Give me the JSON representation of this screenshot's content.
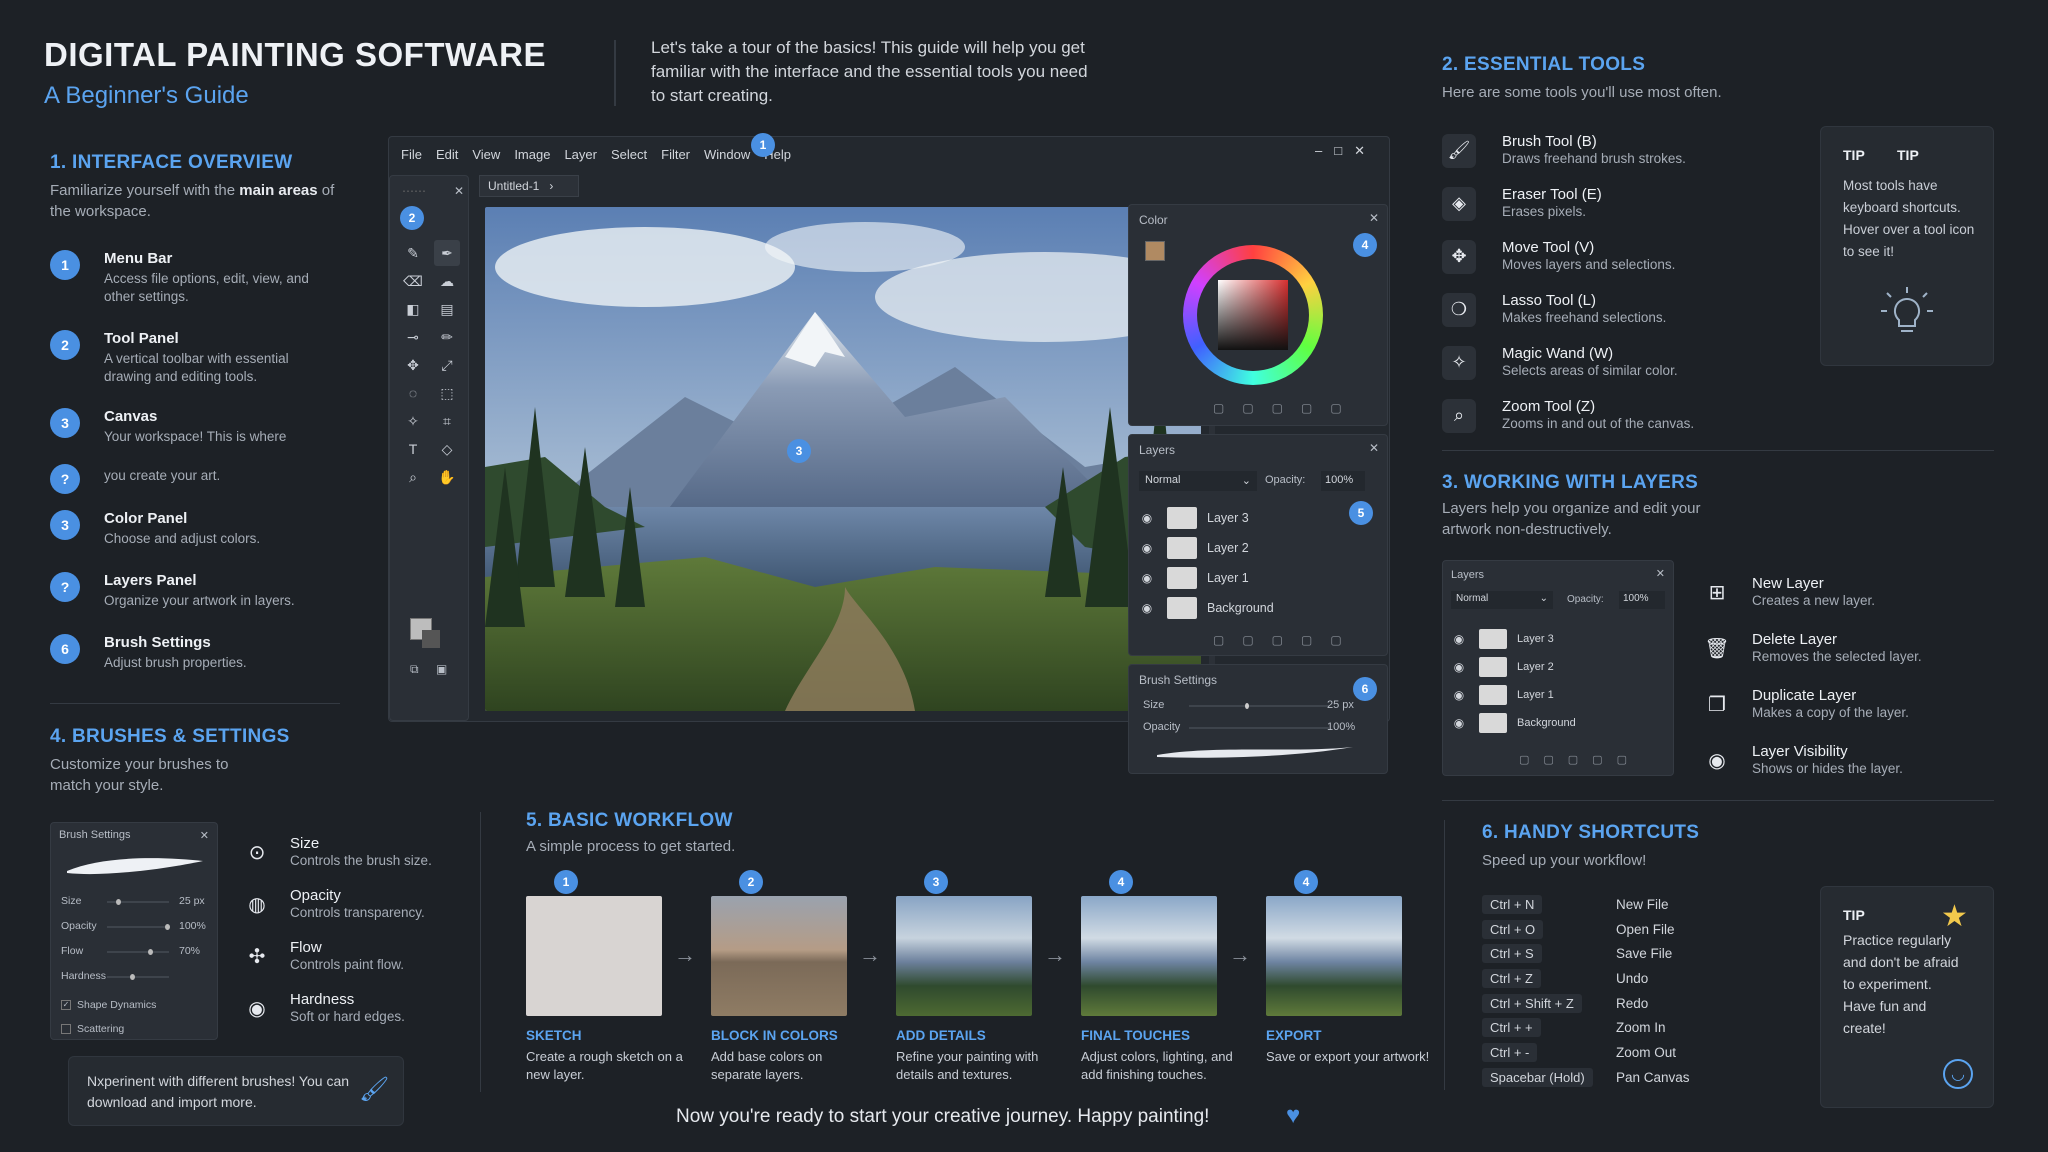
{
  "header": {
    "title": "DIGITAL PAINTING SOFTWARE",
    "subtitle": "A Beginner's Guide",
    "intro": "Let's take a tour of the basics! This guide will help you get familiar with the interface and the essential tools you need to start creating."
  },
  "interface_overview": {
    "title": "1. INTERFACE OVERVIEW",
    "desc_pre": "Familiarize yourself with the ",
    "desc_bold": "main areas",
    "desc_post": " of the workspace.",
    "items": [
      {
        "badge": "1",
        "title": "Menu Bar",
        "desc": "Access file options, edit, view, and other settings."
      },
      {
        "badge": "2",
        "title": "Tool Panel",
        "desc": "A vertical toolbar with essential drawing and editing tools."
      },
      {
        "badge": "3",
        "title": "Canvas",
        "desc": "Your workspace! This is where"
      },
      {
        "badge": "?",
        "title": "",
        "desc": "you create your art."
      },
      {
        "badge": "3",
        "title": "Color Panel",
        "desc": "Choose and adjust colors."
      },
      {
        "badge": "?",
        "title": "Layers Panel",
        "desc": "Organize your artwork in layers."
      },
      {
        "badge": "6",
        "title": "Brush Settings",
        "desc": "Adjust brush properties."
      }
    ]
  },
  "app": {
    "menu": [
      "File",
      "Edit",
      "View",
      "Image",
      "Layer",
      "Select",
      "Filter",
      "Window",
      "Help"
    ],
    "tab": "Untitled-1",
    "color_panel_title": "Color",
    "layers_panel_title": "Layers",
    "blend_mode": "Normal",
    "opacity_label": "Opacity:",
    "opacity_value": "100%",
    "layers": [
      "Layer 3",
      "Layer 2",
      "Layer 1",
      "Background"
    ],
    "brush_settings_title": "Brush Settings",
    "size_label": "Size",
    "size_value": "25 px",
    "opacity_short": "Opacity",
    "opacity_short_value": "100%",
    "badges": [
      "1",
      "2",
      "3",
      "4",
      "5",
      "6"
    ]
  },
  "essential_tools": {
    "title": "2. ESSENTIAL TOOLS",
    "desc": "Here are some tools you'll use most often.",
    "tools": [
      {
        "icon": "brush-icon",
        "title": "Brush Tool (B)",
        "desc": "Draws freehand brush strokes."
      },
      {
        "icon": "eraser-icon",
        "title": "Eraser Tool (E)",
        "desc": "Erases pixels."
      },
      {
        "icon": "move-icon",
        "title": "Move Tool (V)",
        "desc": "Moves layers and selections."
      },
      {
        "icon": "lasso-icon",
        "title": "Lasso Tool (L)",
        "desc": "Makes freehand selections."
      },
      {
        "icon": "magic-wand-icon",
        "title": "Magic Wand (W)",
        "desc": "Selects areas of similar color."
      },
      {
        "icon": "zoom-icon",
        "title": "Zoom Tool (Z)",
        "desc": "Zooms in and out of the canvas."
      }
    ],
    "tip_label": "TIP",
    "tip_label2": "TIP",
    "tip_text": "Most tools have keyboard shortcuts. Hover over a tool icon to see it!"
  },
  "layers_section": {
    "title": "3. WORKING WITH LAYERS",
    "desc": "Layers help you organize and edit your artwork non-destructively.",
    "actions": [
      {
        "icon": "new-layer-icon",
        "title": "New Layer",
        "desc": "Creates a new layer."
      },
      {
        "icon": "delete-layer-icon",
        "title": "Delete Layer",
        "desc": "Removes the selected layer."
      },
      {
        "icon": "duplicate-layer-icon",
        "title": "Duplicate Layer",
        "desc": "Makes a copy of the layer."
      },
      {
        "icon": "visibility-icon",
        "title": "Layer Visibility",
        "desc": "Shows or hides the layer."
      }
    ]
  },
  "brushes_section": {
    "title": "4. BRUSHES & SETTINGS",
    "desc": "Customize your brushes to match your style.",
    "panel_title": "Brush Settings",
    "rows": [
      {
        "label": "Size",
        "value": "25 px",
        "pos": 0.15
      },
      {
        "label": "Opacity",
        "value": "100%",
        "pos": 1.0
      },
      {
        "label": "Flow",
        "value": "70%",
        "pos": 0.7
      },
      {
        "label": "Hardness",
        "value": "",
        "pos": 0.4
      }
    ],
    "checks": [
      "Shape Dynamics",
      "Scattering"
    ],
    "props": [
      {
        "icon": "size-icon",
        "title": "Size",
        "desc": "Controls the brush size."
      },
      {
        "icon": "opacity-icon",
        "title": "Opacity",
        "desc": "Controls transparency."
      },
      {
        "icon": "flow-icon",
        "title": "Flow",
        "desc": "Controls paint flow."
      },
      {
        "icon": "hardness-icon",
        "title": "Hardness",
        "desc": "Soft or hard edges."
      }
    ],
    "note": "Nxperinent with different brushes! You can download and import more."
  },
  "workflow": {
    "title": "5. BASIC WORKFLOW",
    "desc": "A simple process to get started.",
    "steps": [
      {
        "badge": "1",
        "title": "SKETCH",
        "desc": "Create a rough sketch on a new layer."
      },
      {
        "badge": "2",
        "title": "BLOCK IN COLORS",
        "desc": "Add base colors on separate layers."
      },
      {
        "badge": "3",
        "title": "ADD DETAILS",
        "desc": "Refine your painting with details and textures."
      },
      {
        "badge": "4",
        "title": "FINAL TOUCHES",
        "desc": "Adjust colors, lighting, and add finishing touches."
      },
      {
        "badge": "4",
        "title": "EXPORT",
        "desc": "Save or export your artwork!"
      }
    ]
  },
  "shortcuts": {
    "title": "6. HANDY SHORTCUTS",
    "desc": "Speed up your workflow!",
    "items": [
      {
        "key": "Ctrl + N",
        "action": "New File"
      },
      {
        "key": "Ctrl + O",
        "action": "Open File"
      },
      {
        "key": "Ctrl + S",
        "action": "Save File"
      },
      {
        "key": "Ctrl + Z",
        "action": "Undo"
      },
      {
        "key": "Ctrl + Shift + Z",
        "action": "Redo"
      },
      {
        "key": "Ctrl + +",
        "action": "Zoom In"
      },
      {
        "key": "Ctrl + -",
        "action": "Zoom Out"
      },
      {
        "key": "Spacebar (Hold)",
        "action": "Pan Canvas"
      }
    ],
    "tip_label": "TIP",
    "tip_text": "Practice regularly and don't be afraid to experiment. Have fun and create!"
  },
  "footer": "Now you're ready to start your creative journey. Happy painting!"
}
